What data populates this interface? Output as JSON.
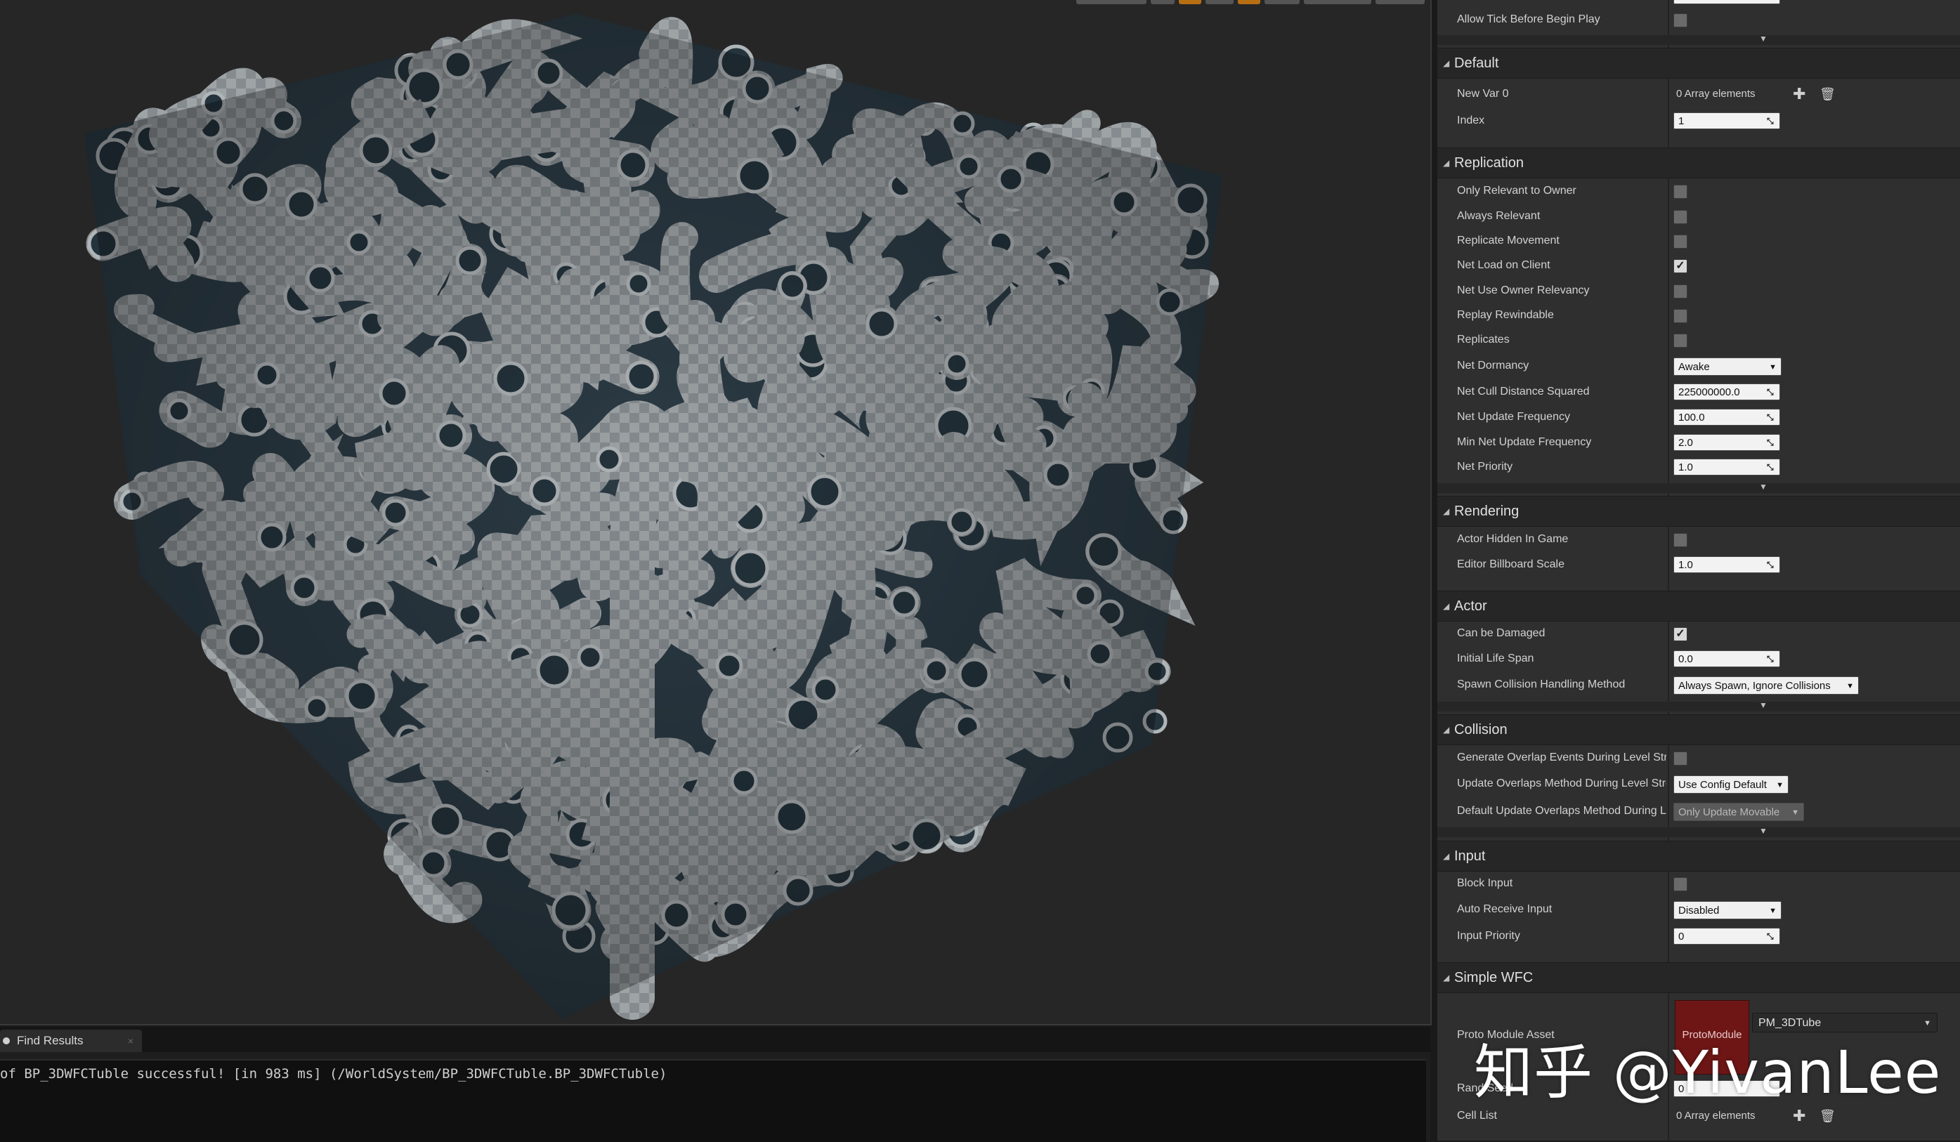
{
  "colors": {
    "viewport_bg": "#262626",
    "panel_bg": "#2f2f2f",
    "header_bg": "#262626",
    "accent_orange": "#b86e12",
    "asset_thumb": "#6e1616"
  },
  "bottom": {
    "tab_label": "Find Results",
    "log_text": "of BP_3DWFCTuble successful! [in 983 ms] (/WorldSystem/BP_3DWFCTuble.BP_3DWFCTuble)"
  },
  "details": {
    "top_rows": {
      "allow_tick": "Allow Tick Before Begin Play"
    },
    "default": {
      "label": "Default",
      "new_var": "New Var 0",
      "new_var_value": "0 Array elements",
      "index": "Index",
      "index_value": "1"
    },
    "replication": {
      "label": "Replication",
      "only_relevant": "Only Relevant to Owner",
      "always_relevant": "Always Relevant",
      "replicate_movement": "Replicate Movement",
      "net_load": "Net Load on Client",
      "net_use_owner": "Net Use Owner Relevancy",
      "replay_rewindable": "Replay Rewindable",
      "replicates": "Replicates",
      "net_dormancy": "Net Dormancy",
      "net_dormancy_value": "Awake",
      "net_cull": "Net Cull Distance Squared",
      "net_cull_value": "225000000.0",
      "net_update_freq": "Net Update Frequency",
      "net_update_freq_value": "100.0",
      "min_net_update": "Min Net Update Frequency",
      "min_net_update_value": "2.0",
      "net_priority": "Net Priority",
      "net_priority_value": "1.0"
    },
    "rendering": {
      "label": "Rendering",
      "actor_hidden": "Actor Hidden In Game",
      "billboard_scale": "Editor Billboard Scale",
      "billboard_scale_value": "1.0"
    },
    "actor": {
      "label": "Actor",
      "can_be_damaged": "Can be Damaged",
      "initial_life": "Initial Life Span",
      "initial_life_value": "0.0",
      "spawn_collision": "Spawn Collision Handling Method",
      "spawn_collision_value": "Always Spawn, Ignore Collisions"
    },
    "collision": {
      "label": "Collision",
      "gen_overlap": "Generate Overlap Events During Level Stre",
      "update_overlaps": "Update Overlaps Method During Level Stre",
      "update_overlaps_value": "Use Config Default",
      "default_update": "Default Update Overlaps Method During Le",
      "default_update_value": "Only Update Movable"
    },
    "input": {
      "label": "Input",
      "block_input": "Block Input",
      "auto_receive": "Auto Receive Input",
      "auto_receive_value": "Disabled",
      "input_priority": "Input Priority",
      "input_priority_value": "0"
    },
    "simple_wfc": {
      "label": "Simple WFC",
      "proto_module": "Proto Module Asset",
      "thumb_label": "ProtoModule",
      "asset_value": "PM_3DTube",
      "rand_seed": "Rand Seed",
      "rand_seed_value": "0",
      "cell_list": "Cell List",
      "cell_list_value": "0 Array elements"
    }
  },
  "watermark": "知乎 @YivanLee"
}
